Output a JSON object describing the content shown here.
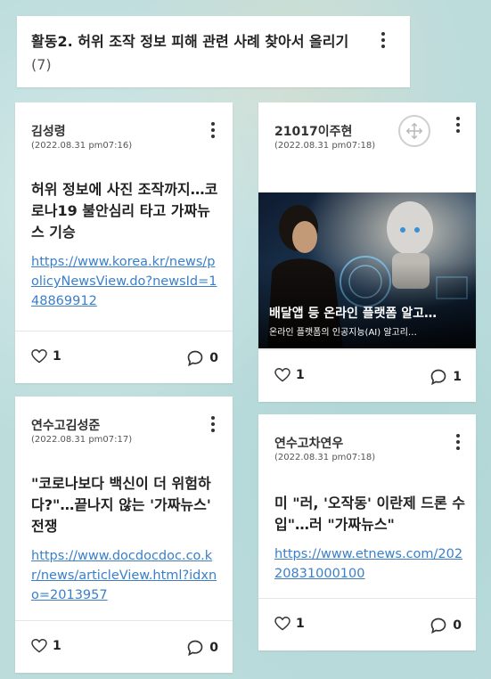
{
  "section": {
    "title": "활동2. 허위 조작 정보 피해 관련 사례 찾아서 올리기",
    "count": "(7)"
  },
  "posts": [
    {
      "author": "김성령",
      "time": "(2022.08.31 pm07:16)",
      "title": "허위 정보에 사진 조작까지…코로나19 불안심리 타고 가짜뉴스 기승",
      "link": "https://www.korea.kr/news/policyNewsView.do?newsId=148869912",
      "likes": "1",
      "comments": "0"
    },
    {
      "author": "21017이주현",
      "time": "(2022.08.31 pm07:18)",
      "image_title": "배달앱 등 온라인 플랫폼 알고…",
      "image_subtitle": "온라인 플랫폼의 인공지능(AI) 알고리…",
      "likes": "1",
      "comments": "1"
    },
    {
      "author": "연수고김성준",
      "time": "(2022.08.31 pm07:17)",
      "title": "\"코로나보다 백신이 더 위험하다?\"…끝나지 않는 '가짜뉴스' 전쟁",
      "link": "https://www.docdocdoc.co.kr/news/articleView.html?idxno=2013957",
      "likes": "1",
      "comments": "0"
    },
    {
      "author": "연수고차연우",
      "time": "(2022.08.31 pm07:18)",
      "title": "미 \"러, '오작동' 이란제 드론 수입\"…러 \"가짜뉴스\"",
      "link": "https://www.etnews.com/20220831000100",
      "likes": "1",
      "comments": "0"
    }
  ],
  "icons": {
    "like": "heart-outline-icon",
    "comment": "speech-bubble-icon",
    "menu": "kebab-menu-icon",
    "move": "move-arrows-icon"
  }
}
